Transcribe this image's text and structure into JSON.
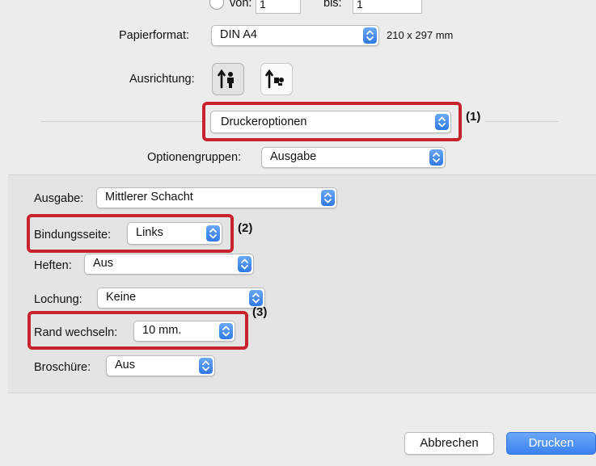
{
  "range": {
    "from_label": "von:",
    "from_value": "1",
    "to_label": "bis:",
    "to_value": "1"
  },
  "paper": {
    "label": "Papierformat:",
    "value": "DIN A4",
    "size": "210 x 297 mm"
  },
  "orientation": {
    "label": "Ausrichtung:",
    "options": [
      "portrait-icon",
      "landscape-icon"
    ],
    "selected": "portrait-icon"
  },
  "printer_options": {
    "value": "Druckeroptionen",
    "callout": "(1)"
  },
  "option_groups": {
    "label": "Optionengruppen:",
    "value": "Ausgabe"
  },
  "settings": {
    "ausgabe": {
      "label": "Ausgabe:",
      "value": "Mittlerer Schacht"
    },
    "bindung": {
      "label": "Bindungsseite:",
      "value": "Links",
      "callout": "(2)"
    },
    "heften": {
      "label": "Heften:",
      "value": "Aus"
    },
    "lochung": {
      "label": "Lochung:",
      "value": "Keine"
    },
    "rand": {
      "label": "Rand wechseln:",
      "value": "10 mm.",
      "callout": "(3)"
    },
    "broschuere": {
      "label": "Broschüre:",
      "value": "Aus"
    }
  },
  "buttons": {
    "cancel": "Abbrechen",
    "print": "Drucken"
  },
  "colors": {
    "highlight": "#c8222c",
    "accent": "#3b82f0",
    "panel": "#e6e6e6",
    "background": "#ececec"
  }
}
